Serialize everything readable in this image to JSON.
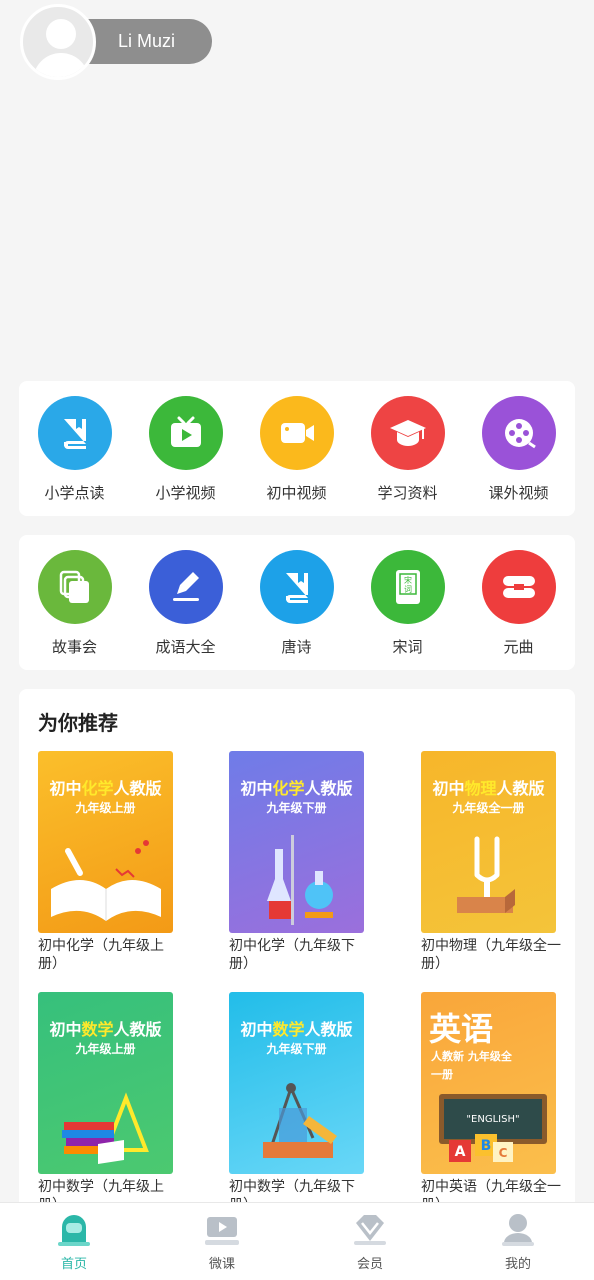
{
  "header": {
    "username": "Li Muzi"
  },
  "row1": [
    {
      "label": "小学点读",
      "color": "#2aa8e8",
      "icon": "book-icon"
    },
    {
      "label": "小学视频",
      "color": "#3cb83a",
      "icon": "tv-play-icon"
    },
    {
      "label": "初中视频",
      "color": "#fbb91c",
      "icon": "video-camera-icon"
    },
    {
      "label": "学习资料",
      "color": "#ee4444",
      "icon": "graduation-cap-icon"
    },
    {
      "label": "课外视频",
      "color": "#9a52d8",
      "icon": "film-reel-icon"
    }
  ],
  "row2": [
    {
      "label": "故事会",
      "color": "#6ab83c",
      "icon": "documents-icon"
    },
    {
      "label": "成语大全",
      "color": "#3b5fd8",
      "icon": "pencil-icon"
    },
    {
      "label": "唐诗",
      "color": "#1da1e8",
      "icon": "book-icon"
    },
    {
      "label": "宋词",
      "color": "#3cb83a",
      "icon": "songci-book-icon"
    },
    {
      "label": "元曲",
      "color": "#ee3d3d",
      "icon": "scroll-icon"
    }
  ],
  "recommend": {
    "title": "为你推荐",
    "books": [
      {
        "pre": "初中",
        "hl": "化学",
        "post": "人教版",
        "sub": "九年级上册",
        "name": "初中化学（九年级上册）",
        "bg": "#f9a825"
      },
      {
        "pre": "初中",
        "hl": "化学",
        "post": "人教版",
        "sub": "九年级下册",
        "name": "初中化学（九年级下册）",
        "bg": "#7b76e8"
      },
      {
        "pre": "初中",
        "hl": "物理",
        "post": "人教版",
        "sub": "九年级全一册",
        "name": "初中物理（九年级全一册）",
        "bg": "#f7b62a"
      },
      {
        "pre": "初中",
        "hl": "数学",
        "post": "人教版",
        "sub": "九年级上册",
        "name": "初中数学（九年级上册）",
        "bg": "#3cc07a"
      },
      {
        "pre": "初中",
        "hl": "数学",
        "post": "人教版",
        "sub": "九年级下册",
        "name": "初中数学（九年级下册）",
        "bg": "#2fc3ee"
      },
      {
        "pre": "英语",
        "hl": "",
        "post": "",
        "sub": "人教新 九年级全一册",
        "name": "初中英语（九年级全一册）",
        "bg": "#f9ab3a"
      }
    ]
  },
  "tabs": [
    {
      "label": "首页",
      "icon": "home-icon",
      "active": true
    },
    {
      "label": "微课",
      "icon": "micro-lesson-icon",
      "active": false
    },
    {
      "label": "会员",
      "icon": "vip-diamond-icon",
      "active": false
    },
    {
      "label": "我的",
      "icon": "profile-icon",
      "active": false
    }
  ]
}
